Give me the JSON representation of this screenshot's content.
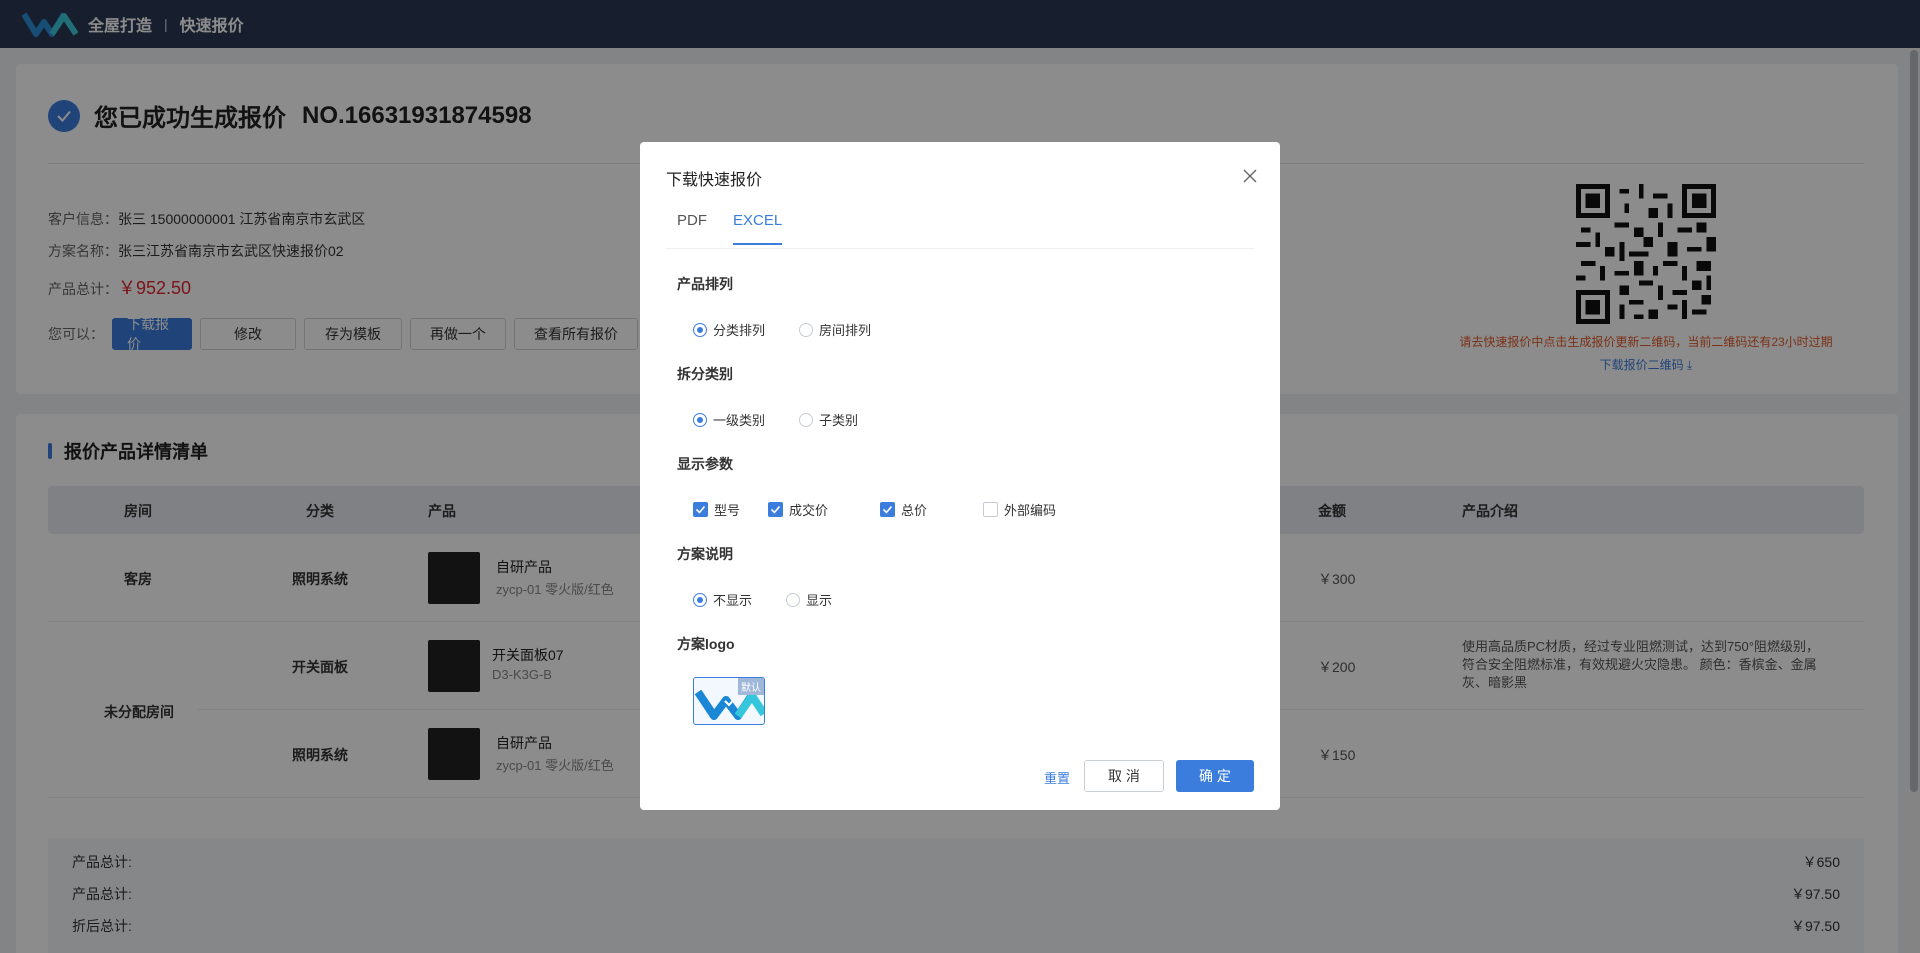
{
  "topbar": {
    "brand": "全屋打造",
    "separator": "|",
    "subtitle": "快速报价"
  },
  "success": {
    "title": "您已成功生成报价",
    "quote_no": "NO.16631931874598"
  },
  "info": {
    "customer_label": "客户信息：",
    "customer_value": "张三  15000000001  江苏省南京市玄武区",
    "plan_label": "方案名称：",
    "plan_value": "张三江苏省南京市玄武区快速报价02",
    "total_label": "产品总计：",
    "total_value": "￥952.50"
  },
  "actions": {
    "label": "您可以：",
    "download": "下载报价",
    "edit": "修改",
    "save_template": "存为模板",
    "redo": "再做一个",
    "view_all": "查看所有报价"
  },
  "qr": {
    "tip": "请去快速报价中点击生成报价更新二维码，当前二维码还有23小时过期",
    "download": "下载报价二维码"
  },
  "list": {
    "title": "报价产品详情清单",
    "headers": {
      "room": "房间",
      "category": "分类",
      "product": "产品",
      "amount": "金额",
      "intro": "产品介绍"
    },
    "rows": [
      {
        "room": "客房",
        "category": "照明系统",
        "name": "自研产品",
        "model": "zycp-01 零火版/红色",
        "amount": "￥300",
        "intro": ""
      },
      {
        "room": "未分配房间",
        "category": "开关面板",
        "name": "开关面板07",
        "model": "D3-K3G-B",
        "amount": "￥200",
        "intro": "使用高品质PC材质，经过专业阻燃测试，达到750°阻燃级别，符合安全阻燃标准，有效规避火灾隐患。 颜色：香槟金、金属灰、暗影黑"
      },
      {
        "room": "",
        "category": "照明系统",
        "name": "自研产品",
        "model": "zycp-01 零火版/红色",
        "amount": "￥150",
        "intro": ""
      }
    ]
  },
  "summary": [
    {
      "label": "产品总计:",
      "value": "￥650"
    },
    {
      "label": "产品总计:",
      "value": "￥97.50"
    },
    {
      "label": "折后总计:",
      "value": "￥97.50"
    }
  ],
  "modal": {
    "title": "下载快速报价",
    "tabs": [
      "PDF",
      "EXCEL"
    ],
    "active_tab": "EXCEL",
    "groups": {
      "sort": {
        "label": "产品排列",
        "options": [
          "分类排列",
          "房间排列"
        ],
        "selected": "分类排列"
      },
      "split": {
        "label": "拆分类别",
        "options": [
          "一级类别",
          "子类别"
        ],
        "selected": "一级类别"
      },
      "params": {
        "label": "显示参数",
        "options": [
          "型号",
          "成交价",
          "总价",
          "外部编码"
        ],
        "checked": [
          "型号",
          "成交价",
          "总价"
        ]
      },
      "desc": {
        "label": "方案说明",
        "options": [
          "不显示",
          "显示"
        ],
        "selected": "不显示"
      },
      "logo": {
        "label": "方案logo",
        "badge": "默认"
      }
    },
    "reset": "重置",
    "cancel": "取 消",
    "confirm": "确 定"
  },
  "colors": {
    "accent": "#3b7ddd",
    "topbar": "#2b3a55",
    "price": "#e0262f",
    "warning": "#e05a2b"
  }
}
